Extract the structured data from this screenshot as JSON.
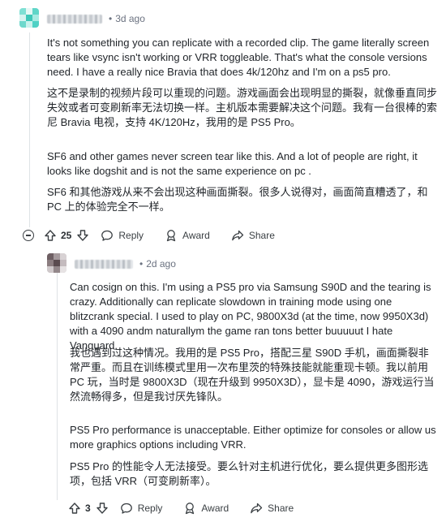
{
  "comment1": {
    "dot": "•",
    "time": "3d ago",
    "paragraphs": [
      "It's not something you can replicate with a recorded clip. The game literally screen tears like vsync isn't working or VRR toggleable. That's what the console versions need. I have a really nice Bravia that does 4k/120hz and I'm on a ps5 pro.",
      "这不是录制的视频片段可以重现的问题。游戏画面会出现明显的撕裂，就像垂直同步失效或者可变刷新率无法切换一样。主机版本需要解决这个问题。我有一台很棒的索尼 Bravia 电视，支持 4K/120Hz，我用的是 PS5 Pro。",
      "SF6 and other games never screen tear like this. And a lot of people are right, it looks like dogshit and is not the same experience on pc .",
      "SF6 和其他游戏从来不会出现这种画面撕裂。很多人说得对，画面简直糟透了，和 PC 上的体验完全不一样。"
    ],
    "votes": "25",
    "reply_label": "Reply",
    "award_label": "Award",
    "share_label": "Share"
  },
  "comment2": {
    "dot": "•",
    "time": "2d ago",
    "paragraphs": [
      "Can cosign on this. I'm using a PS5 pro via Samsung S90D and the tearing is crazy. Additionally can replicate slowdown in training mode using one blitzcrank special. I used to play on PC, 9800X3d (at the time, now 9950X3d) with a 4090 andm naturallym the game ran tons better buuuuut I hate Vanguard.",
      "我也遇到过这种情况。我用的是 PS5 Pro，搭配三星 S90D 手机，画面撕裂非常严重。而且在训练模式里用一次布里茨的特殊技能就能重现卡顿。我以前用 PC 玩，当时是 9800X3D（现在升级到 9950X3D），显卡是 4090，游戏运行当然流畅得多，但是我讨厌先锋队。",
      "PS5 Pro performance is unacceptable. Either optimize for consoles or allow us more graphics options including VRR.",
      "PS5 Pro 的性能令人无法接受。要么针对主机进行优化，要么提供更多图形选项，包括 VRR（可变刷新率）。"
    ],
    "votes": "3",
    "reply_label": "Reply",
    "award_label": "Award",
    "share_label": "Share"
  },
  "icons": [
    "collapse-icon",
    "upvote-icon",
    "downvote-icon",
    "reply-icon",
    "award-icon",
    "share-icon"
  ],
  "colors": {
    "text": "#1f2328",
    "meta": "#6b7280",
    "thread_line": "#dfe3e6",
    "avatar1": "#4fd1c5",
    "avatar2": "#8b7d80"
  }
}
